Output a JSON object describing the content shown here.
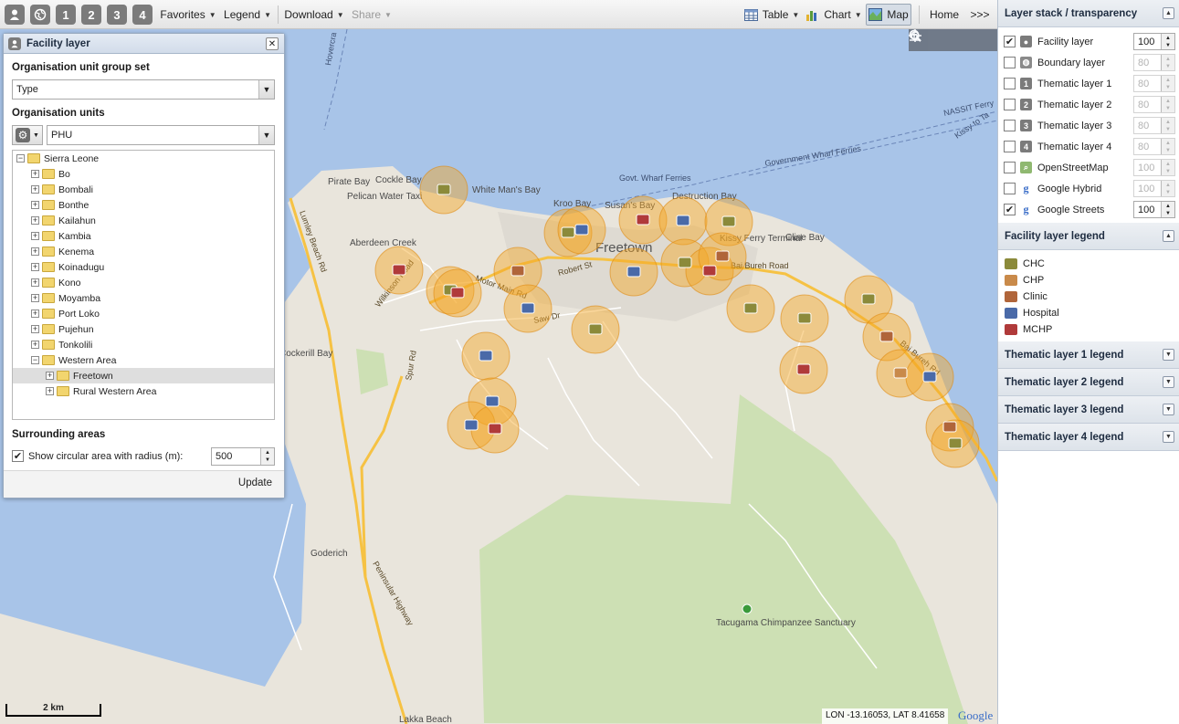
{
  "toolbar": {
    "buttons": [
      "1",
      "2",
      "3",
      "4"
    ],
    "favorites": "Favorites",
    "legend": "Legend",
    "download": "Download",
    "share": "Share",
    "table": "Table",
    "chart": "Chart",
    "map": "Map",
    "home": "Home",
    "more": ">>>"
  },
  "map": {
    "place_labels": [
      "Freetown",
      "Pirate Bay",
      "Cockle Bay",
      "White Man's Bay",
      "Pelican Water Taxi",
      "Aberdeen Creek",
      "Kroo Bay",
      "Susan's Bay",
      "Destruction Bay",
      "Kissy Ferry Terminal",
      "Cline Bay",
      "Cockerill Bay",
      "Goderich",
      "Tacugama Chimpanzee Sanctuary",
      "Lakka Beach",
      "Govt. Wharf Ferries",
      "Government Wharf Ferries",
      "NASSIT Ferry",
      "Kissy to Ta",
      "Hovercra"
    ],
    "road_labels": [
      "Lumley Beach Rd",
      "Wilkinson Road",
      "Motor Main Rd",
      "Spur Rd",
      "Peninsular Highway",
      "Bai Bureh Road",
      "Bai Bureh Rd",
      "Robert St",
      "Saw Dr"
    ],
    "scale": "2 km",
    "coordinates": "LON -13.16053, LAT 8.41658",
    "attribution": "Google"
  },
  "facility_panel": {
    "title": "Facility layer",
    "group_set_label": "Organisation unit group set",
    "group_set_value": "Type",
    "org_units_label": "Organisation units",
    "level_value": "PHU",
    "tree": {
      "root": "Sierra Leone",
      "children": [
        "Bo",
        "Bombali",
        "Bonthe",
        "Kailahun",
        "Kambia",
        "Kenema",
        "Koinadugu",
        "Kono",
        "Moyamba",
        "Port Loko",
        "Pujehun",
        "Tonkolili",
        "Western Area"
      ],
      "western_children": [
        "Freetown",
        "Rural Western Area"
      ]
    },
    "surrounding_label": "Surrounding areas",
    "show_circle_label": "Show circular area with radius (m):",
    "radius": "500",
    "update": "Update"
  },
  "layer_stack": {
    "title": "Layer stack / transparency",
    "layers": [
      {
        "name": "Facility layer",
        "checked": true,
        "opacity": "100",
        "icon": "facility-icon"
      },
      {
        "name": "Boundary layer",
        "checked": false,
        "opacity": "80",
        "icon": "boundary-icon"
      },
      {
        "name": "Thematic layer 1",
        "checked": false,
        "opacity": "80",
        "icon": "thematic-1-icon"
      },
      {
        "name": "Thematic layer 2",
        "checked": false,
        "opacity": "80",
        "icon": "thematic-2-icon"
      },
      {
        "name": "Thematic layer 3",
        "checked": false,
        "opacity": "80",
        "icon": "thematic-3-icon"
      },
      {
        "name": "Thematic layer 4",
        "checked": false,
        "opacity": "80",
        "icon": "thematic-4-icon"
      },
      {
        "name": "OpenStreetMap",
        "checked": false,
        "opacity": "100",
        "icon": "osm-icon"
      },
      {
        "name": "Google Hybrid",
        "checked": false,
        "opacity": "100",
        "icon": "google-icon"
      },
      {
        "name": "Google Streets",
        "checked": true,
        "opacity": "100",
        "icon": "google-icon"
      }
    ]
  },
  "facility_legend": {
    "title": "Facility layer legend",
    "items": [
      {
        "label": "CHC",
        "color": "#8b8a3a"
      },
      {
        "label": "CHP",
        "color": "#c98a4a"
      },
      {
        "label": "Clinic",
        "color": "#b0653a"
      },
      {
        "label": "Hospital",
        "color": "#4a6aa8"
      },
      {
        "label": "MCHP",
        "color": "#b03a3a"
      }
    ]
  },
  "collapsed_legends": [
    "Thematic layer 1 legend",
    "Thematic layer 2 legend",
    "Thematic layer 3 legend",
    "Thematic layer 4 legend"
  ]
}
